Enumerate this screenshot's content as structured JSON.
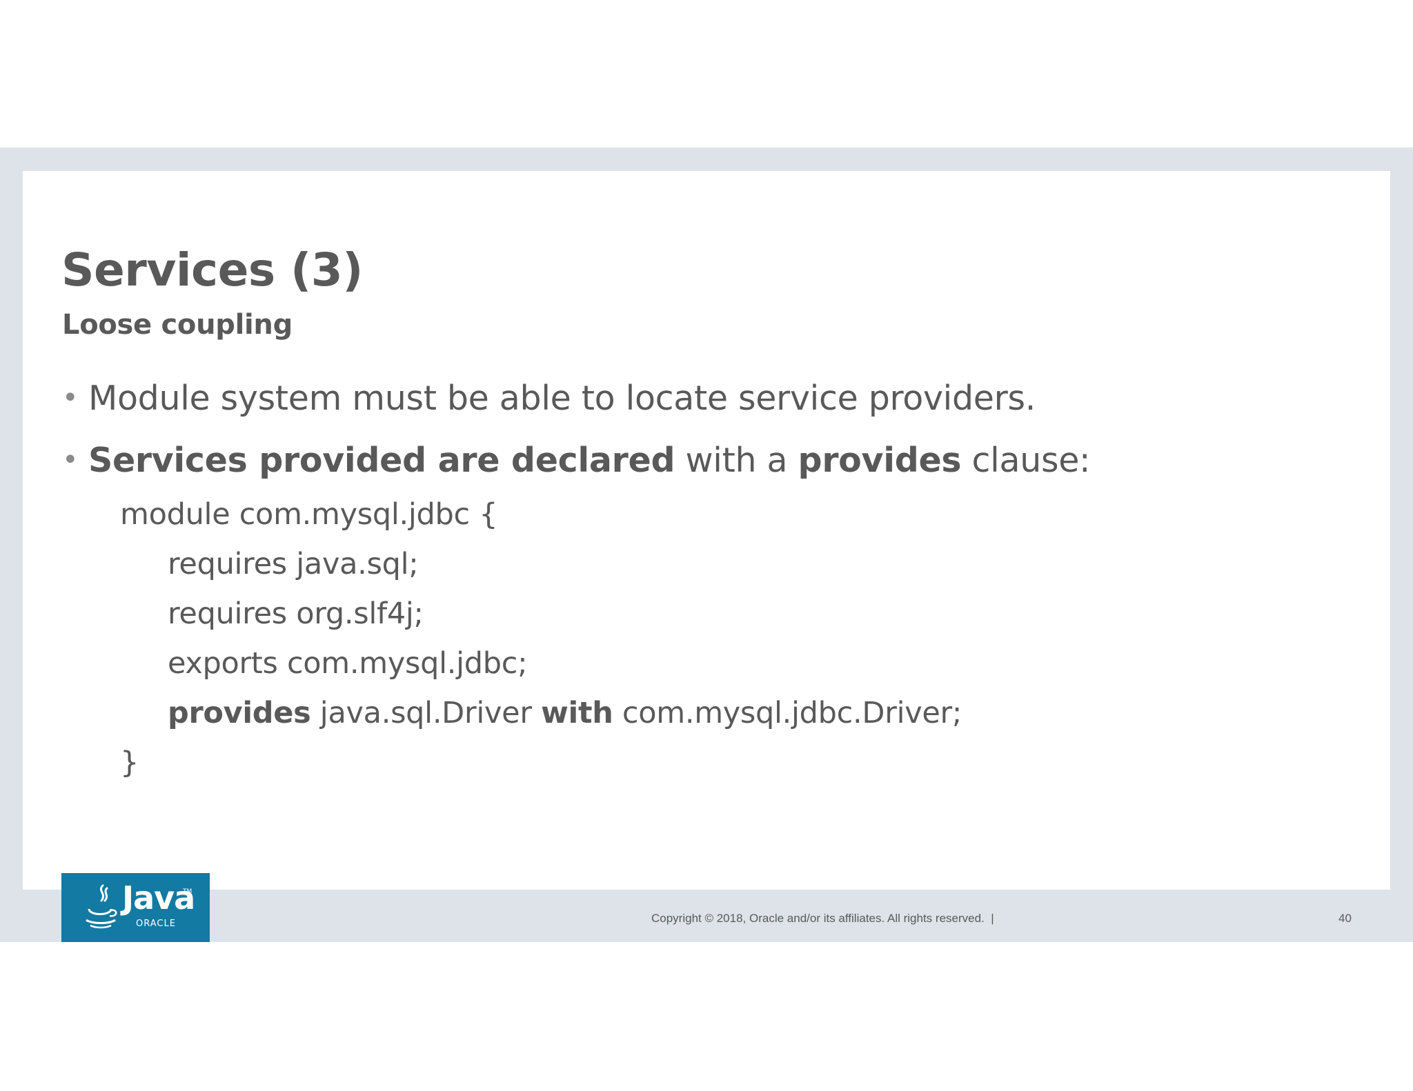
{
  "slide": {
    "title": "Services (3)",
    "subtitle": "Loose coupling",
    "bullets": {
      "b1": "Module system must be able to locate service providers.",
      "b2_bold1": "Services provided are declared",
      "b2_text1": " with a ",
      "b2_bold2": "provides",
      "b2_text2": " clause:"
    },
    "code": {
      "line1": "module com.mysql.jdbc {",
      "line2": "requires java.sql;",
      "line3": "requires org.slf4j;",
      "line4": "exports com.mysql.jdbc;",
      "line5_kw1": "provides",
      "line5_text1": " java.sql.Driver ",
      "line5_kw2": "with",
      "line5_text2": " com.mysql.jdbc.Driver;",
      "line6": "}"
    }
  },
  "footer": {
    "logo_word": "Java",
    "logo_tm": "TM",
    "logo_sub": "ORACLE",
    "copyright": "Copyright © 2018, Oracle and/or its affiliates. All rights reserved.  |",
    "page_number": "40"
  },
  "colors": {
    "text": "#595959",
    "frame": "#dde3e8",
    "logo_bg": "#127aa3"
  },
  "icons": {
    "logo": "java-cup-icon"
  }
}
